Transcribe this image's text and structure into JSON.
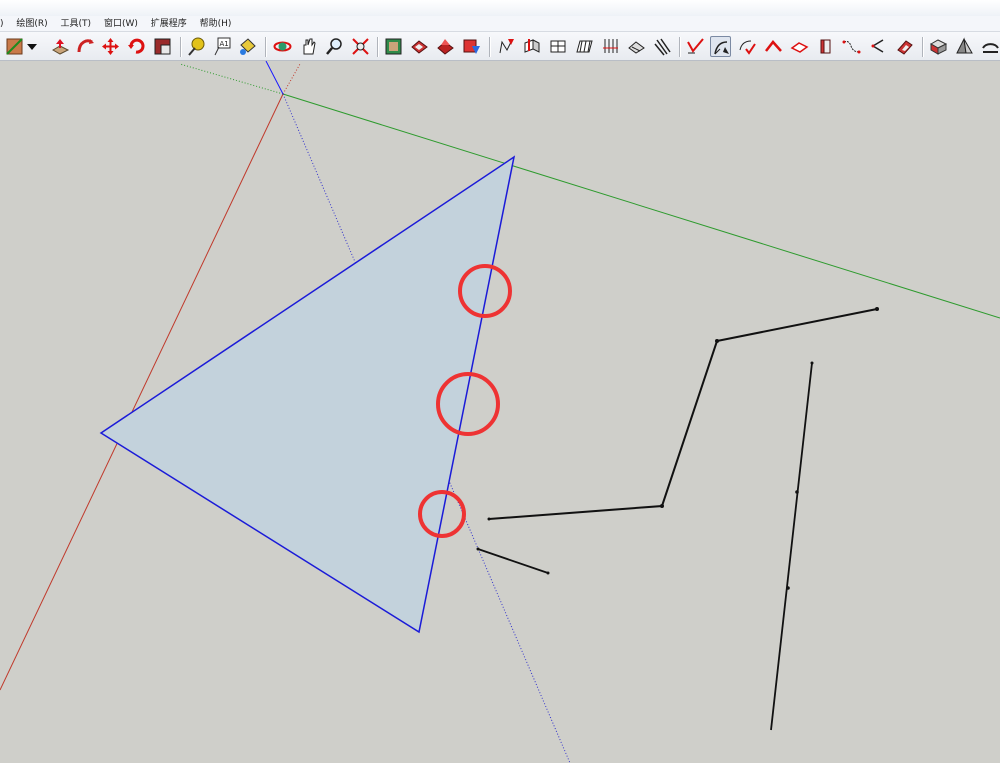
{
  "menu": {
    "items": [
      {
        "label": ")"
      },
      {
        "label": "绘图(R)"
      },
      {
        "label": "工具(T)"
      },
      {
        "label": "窗口(W)"
      },
      {
        "label": "扩展程序"
      },
      {
        "label": "帮助(H)"
      }
    ]
  },
  "colors": {
    "axis_red": "#c0392b",
    "axis_green": "#2e9b2e",
    "axis_blue": "#1a1aff",
    "face_fill": "#c3d2dc",
    "edge": "#1b1bd8",
    "highlight": "#ee3333",
    "line": "#111111",
    "background": "#cfcfca"
  },
  "toolbar": {
    "buttons": [
      {
        "name": "line-tool-icon"
      },
      {
        "name": "dropdown-arrow-icon"
      },
      {
        "name": "push-pull-icon"
      },
      {
        "name": "follow-me-icon"
      },
      {
        "name": "move-icon"
      },
      {
        "name": "rotate-icon"
      },
      {
        "name": "scale-icon"
      },
      {
        "name": "tape-measure-icon"
      },
      {
        "name": "text-label-icon"
      },
      {
        "name": "paint-bucket-icon"
      },
      {
        "name": "orbit-icon"
      },
      {
        "name": "pan-icon"
      },
      {
        "name": "zoom-icon"
      },
      {
        "name": "zoom-extents-icon"
      },
      {
        "name": "scenes-icon"
      },
      {
        "name": "warehouse-icon"
      },
      {
        "name": "share-model-icon"
      },
      {
        "name": "extension-warehouse-icon"
      },
      {
        "name": "sandbox-from-contours-icon"
      },
      {
        "name": "sandbox-from-scratch-icon"
      },
      {
        "name": "smoove-icon"
      },
      {
        "name": "stamp-icon"
      },
      {
        "name": "drape-icon"
      },
      {
        "name": "add-detail-icon"
      },
      {
        "name": "flip-edge-icon"
      },
      {
        "name": "weld-icon"
      },
      {
        "name": "arc-tool-icon"
      },
      {
        "name": "check-edge-icon"
      },
      {
        "name": "roof-icon"
      },
      {
        "name": "face-tool-icon"
      },
      {
        "name": "extrude-icon"
      },
      {
        "name": "curve-icon"
      },
      {
        "name": "bend-icon"
      },
      {
        "name": "fillet-icon"
      },
      {
        "name": "solid-tools-icon"
      },
      {
        "name": "section-icon"
      },
      {
        "name": "arc-edge-icon"
      }
    ]
  }
}
